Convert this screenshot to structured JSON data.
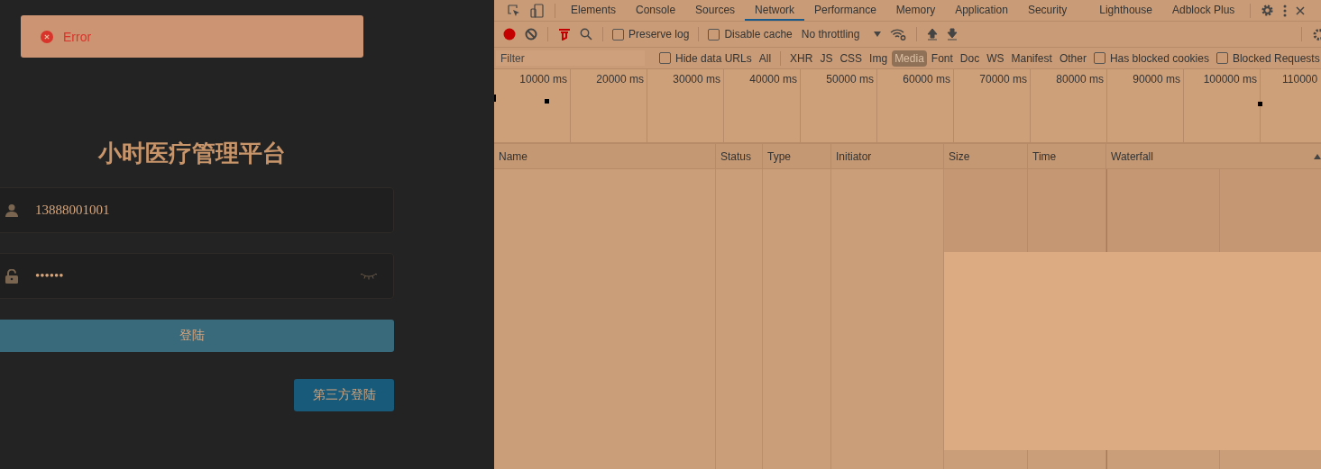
{
  "login": {
    "toast": {
      "kind": "error",
      "message": "Error"
    },
    "title": "小时医疗管理平台",
    "username": {
      "value": "13888001001"
    },
    "password": {
      "value": "••••••",
      "visible": false
    },
    "buttons": [
      {
        "label": "登陆",
        "kind": "primary"
      },
      {
        "label": "第三方登陆",
        "kind": "secondary"
      }
    ]
  },
  "devtools": {
    "tabs": [
      {
        "label": "Elements",
        "selected": false
      },
      {
        "label": "Console",
        "selected": false
      },
      {
        "label": "Sources",
        "selected": false
      },
      {
        "label": "Network",
        "selected": true
      },
      {
        "label": "Performance",
        "selected": false
      },
      {
        "label": "Memory",
        "selected": false
      },
      {
        "label": "Application",
        "selected": false
      },
      {
        "label": "Security",
        "selected": false
      },
      {
        "label": "Lighthouse",
        "selected": false
      },
      {
        "label": "Adblock Plus",
        "selected": false
      }
    ],
    "toolbar": {
      "recording": true,
      "filter_active": true,
      "checkboxes": [
        {
          "label": "Preserve log",
          "checked": false
        },
        {
          "label": "Disable cache",
          "checked": false
        }
      ],
      "throttling": "No throttling"
    },
    "filter_bar": {
      "placeholder": "Filter",
      "hide_data_urls": {
        "label": "Hide data URLs",
        "checked": false
      },
      "types": [
        {
          "label": "All",
          "selected": false
        },
        {
          "label": "XHR",
          "selected": false
        },
        {
          "label": "JS",
          "selected": false
        },
        {
          "label": "CSS",
          "selected": false
        },
        {
          "label": "Img",
          "selected": false
        },
        {
          "label": "Media",
          "selected": true
        },
        {
          "label": "Font",
          "selected": false
        },
        {
          "label": "Doc",
          "selected": false
        },
        {
          "label": "WS",
          "selected": false
        },
        {
          "label": "Manifest",
          "selected": false
        },
        {
          "label": "Other",
          "selected": false
        }
      ],
      "extra_checkboxes": [
        {
          "label": "Has blocked cookies",
          "checked": false
        },
        {
          "label": "Blocked Requests",
          "checked": false
        }
      ]
    },
    "overview": {
      "ticks": [
        "10000 ms",
        "20000 ms",
        "30000 ms",
        "40000 ms",
        "50000 ms",
        "60000 ms",
        "70000 ms",
        "80000 ms",
        "90000 ms",
        "100000 ms",
        "110000"
      ]
    },
    "table": {
      "columns": [
        "Name",
        "Status",
        "Type",
        "Initiator",
        "Size",
        "Time",
        "Waterfall"
      ]
    }
  }
}
